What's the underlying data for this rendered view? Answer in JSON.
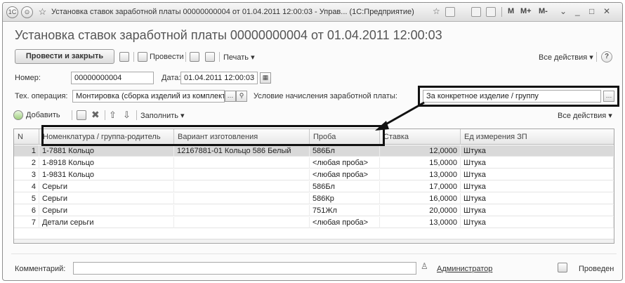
{
  "window": {
    "title": "Установка ставок заработной платы 00000000004 от 01.04.2011 12:00:03 - Управ...  (1С:Предприятие)",
    "controls": [
      "M",
      "M+",
      "M-"
    ]
  },
  "heading": "Установка ставок заработной платы 00000000004 от 01.04.2011 12:00:03",
  "toolbar": {
    "post_and_close": "Провести и закрыть",
    "post": "Провести",
    "print": "Печать ▾",
    "all_actions": "Все действия ▾",
    "help": "?"
  },
  "form": {
    "number_label": "Номер:",
    "number_value": "00000000004",
    "date_label": "Дата:",
    "date_value": "01.04.2011 12:00:03",
    "tech_op_label": "Тех. операция:",
    "tech_op_value": "Монтировка (сборка изделий из комплектующ",
    "condition_label": "Условие начисления заработной платы:",
    "condition_value": "За конкретное изделие / группу"
  },
  "table_toolbar": {
    "add": "Добавить",
    "fill": "Заполнить ▾",
    "all_actions": "Все действия ▾"
  },
  "table": {
    "columns": [
      "N",
      "Номенклатура / группа-родитель",
      "Вариант изготовления",
      "Проба",
      "Ставка",
      "Ед измерения ЗП"
    ],
    "rows": [
      {
        "n": "1",
        "item": "1-7881 Кольцо",
        "variant": "12167881-01 Кольцо 586 Белый",
        "probe": "586Бл",
        "rate": "12,0000",
        "unit": "Штука"
      },
      {
        "n": "2",
        "item": "1-8918 Кольцо",
        "variant": "",
        "probe": "<любая проба>",
        "rate": "15,0000",
        "unit": "Штука"
      },
      {
        "n": "3",
        "item": "1-9831 Кольцо",
        "variant": "",
        "probe": "<любая проба>",
        "rate": "13,0000",
        "unit": "Штука"
      },
      {
        "n": "4",
        "item": "Серьги",
        "variant": "",
        "probe": "586Бл",
        "rate": "17,0000",
        "unit": "Штука"
      },
      {
        "n": "5",
        "item": "Серьги",
        "variant": "",
        "probe": "586Кр",
        "rate": "16,0000",
        "unit": "Штука"
      },
      {
        "n": "6",
        "item": "Серьги",
        "variant": "",
        "probe": "751Жл",
        "rate": "20,0000",
        "unit": "Штука"
      },
      {
        "n": "7",
        "item": "Детали серьги",
        "variant": "",
        "probe": "<любая проба>",
        "rate": "13,0000",
        "unit": "Штука"
      }
    ]
  },
  "footer": {
    "comment_label": "Комментарий:",
    "comment_value": "",
    "author": "Администратор",
    "status": "Проведен"
  }
}
